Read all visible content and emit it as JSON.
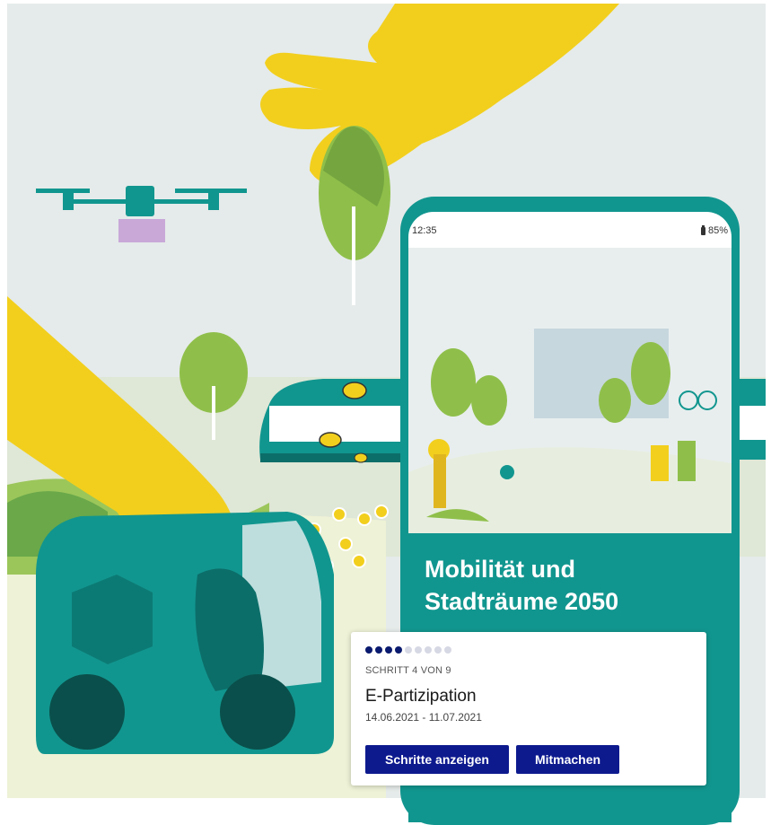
{
  "phone": {
    "time": "12:35",
    "battery": "85%"
  },
  "hero": {
    "title": "Mobilität und\nStadträume 2050"
  },
  "card": {
    "steps_total": 9,
    "steps_current": 4,
    "step_label": "SCHRITT 4 VON 9",
    "step_title": "E-Partizipation",
    "date_range": "14.06.2021 - 11.07.2021",
    "show_steps_label": "Schritte anzeigen",
    "participate_label": "Mitmachen"
  },
  "colors": {
    "teal": "#11968f",
    "yellow": "#f2cf1d",
    "navy_button": "#0d1a8e",
    "sky": "#e6ecec",
    "leaf_green": "#8fbf4a"
  },
  "icons": [
    "battery-icon",
    "drone-icon",
    "bee-icon",
    "hand-icon",
    "tree-icon",
    "train-icon",
    "delivery-vehicle-icon"
  ]
}
